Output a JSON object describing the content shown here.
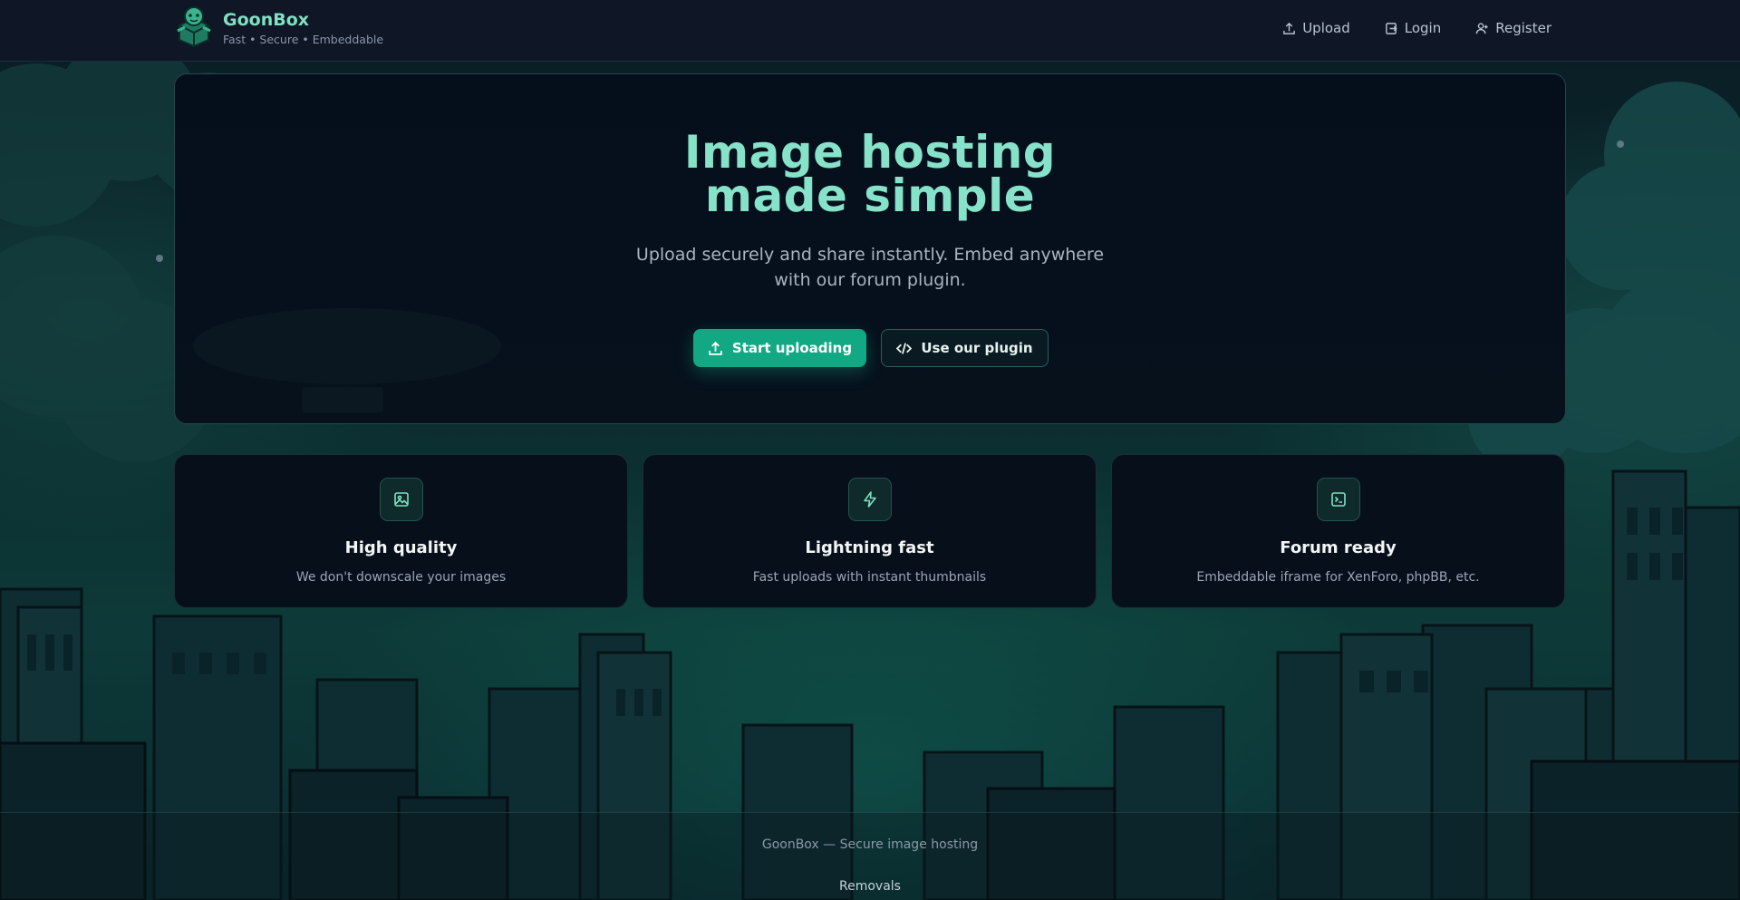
{
  "brand": {
    "name": "GoonBox",
    "tagline": "Fast • Secure • Embeddable"
  },
  "nav": {
    "items": [
      {
        "label": "Upload",
        "icon": "upload-icon"
      },
      {
        "label": "Login",
        "icon": "login-icon"
      },
      {
        "label": "Register",
        "icon": "user-plus-icon"
      }
    ]
  },
  "hero": {
    "title_line1": "Image hosting",
    "title_line2": "made simple",
    "subtitle_line1": "Upload securely and share instantly. Embed anywhere",
    "subtitle_line2": "with our forum plugin.",
    "primary_button": "Start uploading",
    "secondary_button": "Use our plugin"
  },
  "features": [
    {
      "title": "High quality",
      "description": "We don't downscale your images",
      "icon": "image-icon"
    },
    {
      "title": "Lightning fast",
      "description": "Fast uploads with instant thumbnails",
      "icon": "lightning-icon"
    },
    {
      "title": "Forum ready",
      "description": "Embeddable iframe for XenForo, phpBB, etc.",
      "icon": "terminal-icon"
    }
  ],
  "footer": {
    "text": "GoonBox — Secure image hosting",
    "link": "Removals"
  },
  "colors": {
    "accent": "#86e3c9",
    "primary_button": "#13a884",
    "header_bg": "#0f1626",
    "card_bg": "#070f1b"
  }
}
